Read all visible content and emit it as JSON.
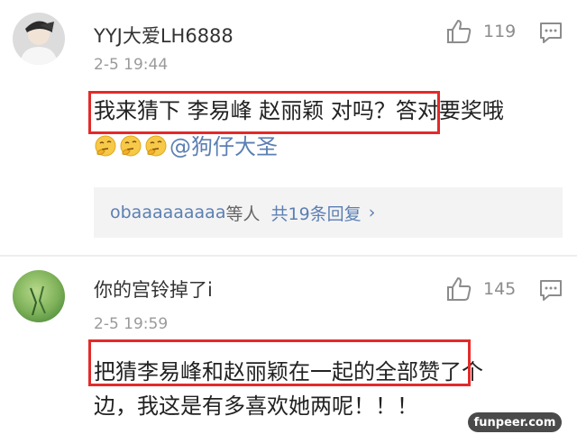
{
  "comments": [
    {
      "username": "YYJ大爱LH6888",
      "timestamp": "2-5 19:44",
      "likes": "119",
      "content_line_1": "我来猜下 李易峰 赵丽颖 对吗？答对要奖哦",
      "content_line_2_mention": "@狗仔大圣",
      "emoji_icon": "thinking-face-emoji",
      "replies": {
        "user": "obaaaaaaaaa",
        "suffix": "等人",
        "link": "共19条回复",
        "arrow": "›"
      }
    },
    {
      "username": "你的宫铃掉了i",
      "timestamp": "2-5 19:59",
      "likes": "145",
      "content_line_1": "把猜李易峰和赵丽颖在一起的全部赞了个",
      "content_line_2": "边，我这是有多喜欢她两呢！！！"
    }
  ],
  "watermark": "funpeer.com",
  "colors": {
    "highlight": "#e32a2a",
    "link": "#5b7fb3",
    "muted": "#9a9a9a",
    "reply_bg": "#f3f3f3"
  }
}
